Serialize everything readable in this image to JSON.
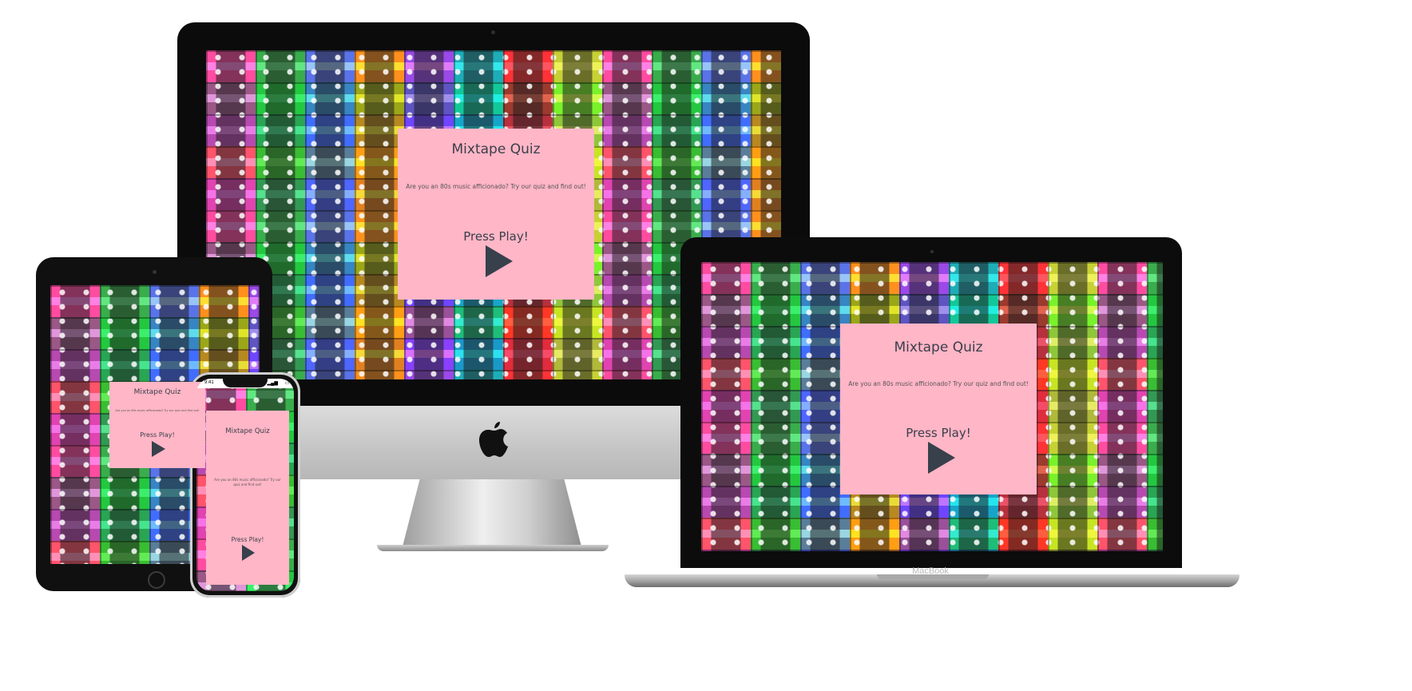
{
  "quiz": {
    "title": "Mixtape Quiz",
    "subtitle": "Are you an 80s music afficionado? Try our quiz and find out!",
    "cta": "Press Play!"
  },
  "devices": {
    "laptop_label": "MacBook",
    "phone_time": "9:41"
  },
  "icons": {
    "play": "play-icon",
    "apple": "apple-logo-icon"
  },
  "colors": {
    "card_background": "#ffb6c7",
    "text": "#3a3f4a",
    "play_icon": "#37404b"
  }
}
